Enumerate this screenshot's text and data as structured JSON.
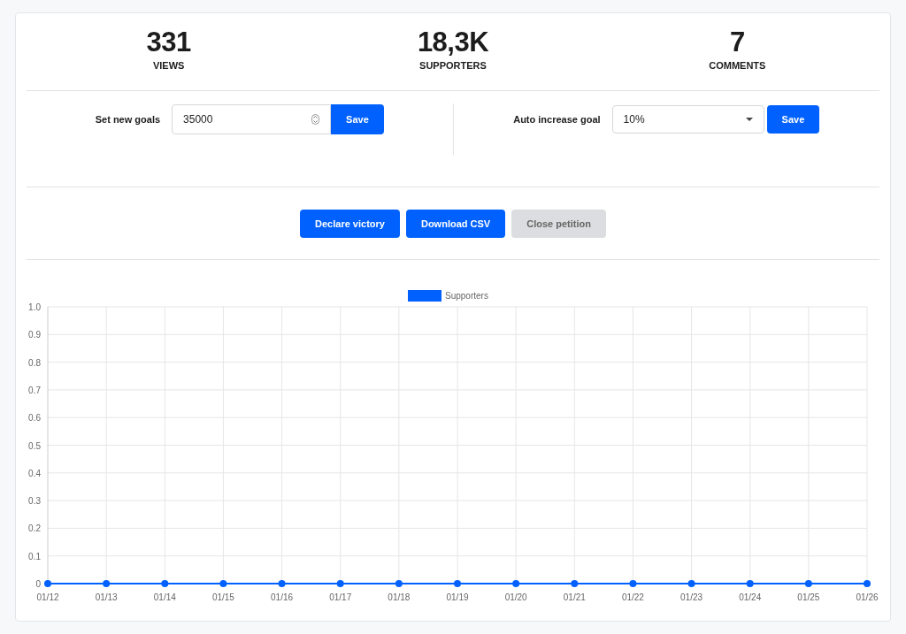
{
  "stats": [
    {
      "value": "331",
      "label": "VIEWS"
    },
    {
      "value": "18,3K",
      "label": "SUPPORTERS"
    },
    {
      "value": "7",
      "label": "COMMENTS"
    }
  ],
  "goals": {
    "label": "Set new goals",
    "value": "35000",
    "button": "Save"
  },
  "auto_increase": {
    "label": "Auto increase goal",
    "value": "10%",
    "button": "Save"
  },
  "actions": [
    {
      "label": "Declare victory",
      "disabled": false
    },
    {
      "label": "Download CSV",
      "disabled": false
    },
    {
      "label": "Close petition",
      "disabled": true
    }
  ],
  "chart": {
    "chart_data": {
      "type": "line",
      "categories": [
        "01/12",
        "01/13",
        "01/14",
        "01/15",
        "01/16",
        "01/17",
        "01/18",
        "01/19",
        "01/20",
        "01/21",
        "01/22",
        "01/23",
        "01/24",
        "01/25",
        "01/26"
      ],
      "grid": true,
      "series": [
        {
          "name": "Supporters",
          "color": "#0061ff",
          "marker": true,
          "values": [
            0,
            0,
            0,
            0,
            0,
            0,
            0,
            0,
            0,
            0,
            0,
            0,
            0,
            0,
            0
          ]
        }
      ],
      "ylim": [
        0,
        1
      ],
      "yticks": [
        0,
        0.1,
        0.2,
        0.3,
        0.4,
        0.5,
        0.6,
        0.7,
        0.8,
        0.9,
        {
          "value": 1,
          "label": "1.0"
        }
      ]
    }
  }
}
